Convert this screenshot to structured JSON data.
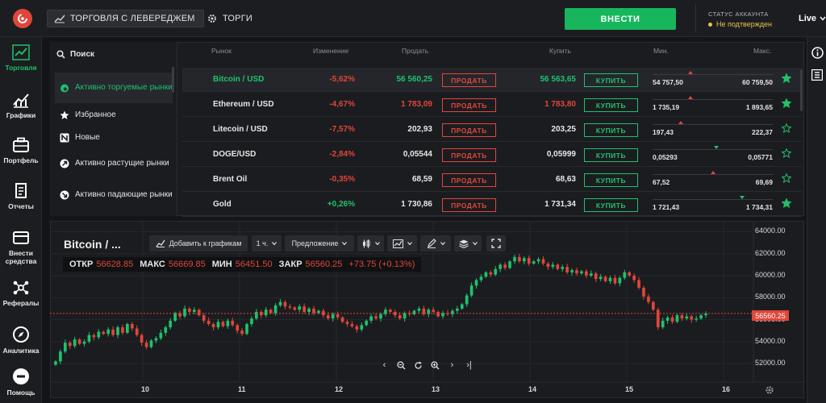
{
  "topbar": {
    "tabs": [
      {
        "label": "ТОРГОВЛЯ С ЛЕВЕРЕДЖЕМ",
        "icon": "chart-line-icon",
        "active": true
      },
      {
        "label": "ТОРГИ",
        "icon": "gear-icon",
        "active": false
      }
    ],
    "deposit_label": "ВНЕСТИ",
    "account_title": "СТАТУС АККАУНТА",
    "account_status": "Не подтвержден",
    "live_label": "Live"
  },
  "nav": [
    {
      "label": "Торговля",
      "icon": "trading-icon",
      "active": true
    },
    {
      "label": "Графики",
      "icon": "charts-icon",
      "active": false
    },
    {
      "label": "Портфель",
      "icon": "portfolio-icon",
      "active": false
    },
    {
      "label": "Отчеты",
      "icon": "reports-icon",
      "active": false
    },
    {
      "label": "Внести средства",
      "icon": "deposit-icon",
      "active": false
    },
    {
      "label": "Рефералы",
      "icon": "referrals-icon",
      "active": false
    },
    {
      "label": "Аналитика",
      "icon": "analytics-icon",
      "active": false
    },
    {
      "label": "Помощь",
      "icon": "help-icon",
      "active": false
    }
  ],
  "markets": {
    "search_label": "Поиск",
    "categories": [
      {
        "label": "Активно торгуемые рынки",
        "icon": "fire-icon",
        "active": true
      },
      {
        "label": "Избранное",
        "icon": "star-icon",
        "active": false
      },
      {
        "label": "Новые",
        "icon": "new-icon",
        "active": false
      },
      {
        "label": "Активно растущие рынки",
        "icon": "arrow-up-icon",
        "active": false
      },
      {
        "label": "Активно падающие рынки",
        "icon": "arrow-down-icon",
        "active": false
      }
    ],
    "columns": {
      "market": "Рынок",
      "change": "Изменение",
      "sell": "Продать",
      "buy": "Купить",
      "min": "Мин.",
      "max": "Макс."
    },
    "sell_btn": "ПРОДАТЬ",
    "buy_btn": "КУПИТЬ",
    "rows": [
      {
        "name": "Bitcoin / USD",
        "change": "-5,62%",
        "dir": "down",
        "sell": "56 560,25",
        "sell_color": "green",
        "buy": "56 563,65",
        "buy_color": "green",
        "min": "54 757,50",
        "max": "60 759,50",
        "range_pos": 0.3,
        "range_color": "red",
        "fav": true,
        "selected": true
      },
      {
        "name": "Ethereum / USD",
        "change": "-4,67%",
        "dir": "down",
        "sell": "1 783,09",
        "sell_color": "red",
        "buy": "1 783,80",
        "buy_color": "red",
        "min": "1 735,19",
        "max": "1 893,65",
        "range_pos": 0.3,
        "range_color": "red",
        "fav": true,
        "selected": false
      },
      {
        "name": "Litecoin / USD",
        "change": "-7,57%",
        "dir": "down",
        "sell": "202,93",
        "sell_color": "white",
        "buy": "203,25",
        "buy_color": "white",
        "min": "197,43",
        "max": "222,37",
        "range_pos": 0.22,
        "range_color": "red",
        "fav": false,
        "selected": false
      },
      {
        "name": "DOGE/USD",
        "change": "-2,84%",
        "dir": "down",
        "sell": "0,05544",
        "sell_color": "white",
        "buy": "0,05999",
        "buy_color": "white",
        "min": "0,05293",
        "max": "0,05771",
        "range_pos": 0.52,
        "range_color": "green",
        "fav": false,
        "selected": false
      },
      {
        "name": "Brent Oil",
        "change": "-0,35%",
        "dir": "down",
        "sell": "68,59",
        "sell_color": "white",
        "buy": "68,63",
        "buy_color": "white",
        "min": "67,52",
        "max": "69,69",
        "range_pos": 0.49,
        "range_color": "red",
        "fav": false,
        "selected": false
      },
      {
        "name": "Gold",
        "change": "+0,26%",
        "dir": "up",
        "sell": "1 730,86",
        "sell_color": "white",
        "buy": "1 731,34",
        "buy_color": "white",
        "min": "1 721,43",
        "max": "1 734,31",
        "range_pos": 0.74,
        "range_color": "green",
        "fav": true,
        "selected": false
      }
    ]
  },
  "chart": {
    "title": "Bitcoin / ...",
    "add_label": "Добавить к графикам",
    "interval_label": "1 ч.",
    "price_type_label": "Предложение",
    "ohlc": {
      "open_label": "ОТКР",
      "open": "56628.85",
      "high_label": "МАКС",
      "high": "56669.85",
      "low_label": "МИН",
      "low": "56451.50",
      "close_label": "ЗАКР",
      "close": "56560.25",
      "change": "+73.75 (+0.13%)"
    },
    "current_price": "56560.25",
    "y_ticks": [
      "64000.00",
      "62000.00",
      "60000.00",
      "58000.00",
      "56000.00",
      "54000.00",
      "52000.00"
    ],
    "x_ticks": [
      "10",
      "11",
      "12",
      "13",
      "14",
      "15",
      "16"
    ],
    "colors": {
      "up": "#1ec26b",
      "down": "#e0463a"
    }
  },
  "chart_data": {
    "type": "candlestick",
    "ylim": [
      51200,
      64400
    ],
    "x_ticks": [
      "10",
      "11",
      "12",
      "13",
      "14",
      "15",
      "16"
    ],
    "y_ticks": [
      64000,
      62000,
      60000,
      58000,
      56000,
      54000,
      52000
    ],
    "last_price": 56560.25,
    "close_series": [
      52200,
      53100,
      53900,
      53600,
      54200,
      53800,
      54000,
      54600,
      54400,
      54900,
      54700,
      55100,
      54600,
      55300,
      54800,
      55600,
      55200,
      54600,
      53900,
      53500,
      54100,
      54300,
      54800,
      55300,
      55900,
      56600,
      56300,
      57000,
      56700,
      56900,
      56400,
      55900,
      55600,
      55300,
      55800,
      55400,
      55900,
      55500,
      55000,
      54700,
      55600,
      56100,
      56700,
      56400,
      56900,
      56600,
      57300,
      57600,
      57200,
      57100,
      56900,
      57200,
      56700,
      57000,
      56600,
      56800,
      56400,
      56100,
      56500,
      56200,
      55800,
      55600,
      55400,
      55100,
      55500,
      55900,
      56300,
      56100,
      56500,
      56900,
      56700,
      56400,
      56100,
      56600,
      56500,
      56800,
      57000,
      56500,
      56900,
      56700,
      56300,
      56600,
      56500,
      56800,
      57000,
      57400,
      58200,
      59100,
      59600,
      59900,
      60300,
      60100,
      60600,
      61000,
      60700,
      61300,
      61700,
      61300,
      61600,
      61100,
      61300,
      61500,
      61100,
      60800,
      61000,
      60600,
      60800,
      60300,
      60500,
      60200,
      60400,
      60000,
      60200,
      59700,
      59900,
      59500,
      59800,
      59300,
      59800,
      60300,
      60000,
      59600,
      58900,
      58100,
      57600,
      56900,
      55300,
      55900,
      56200,
      55800,
      56400,
      56100,
      56300,
      56000,
      56100,
      56400,
      56560
    ]
  },
  "rail": {
    "icons": [
      "info-icon",
      "collapse-icon"
    ]
  }
}
